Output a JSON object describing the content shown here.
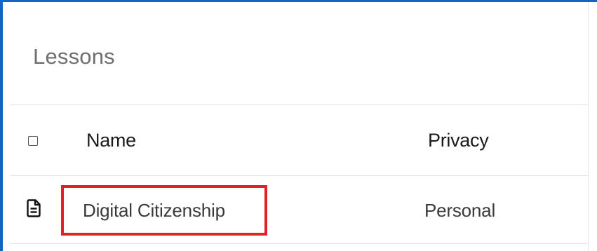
{
  "page": {
    "title": "Lessons",
    "accent_color": "#1565c0",
    "highlight_color": "#e0202b"
  },
  "table": {
    "columns": [
      "Name",
      "Privacy"
    ],
    "select_all_checked": false,
    "rows": [
      {
        "icon": "document-icon",
        "name": "Digital Citizenship",
        "privacy": "Personal",
        "highlighted": true
      }
    ]
  }
}
